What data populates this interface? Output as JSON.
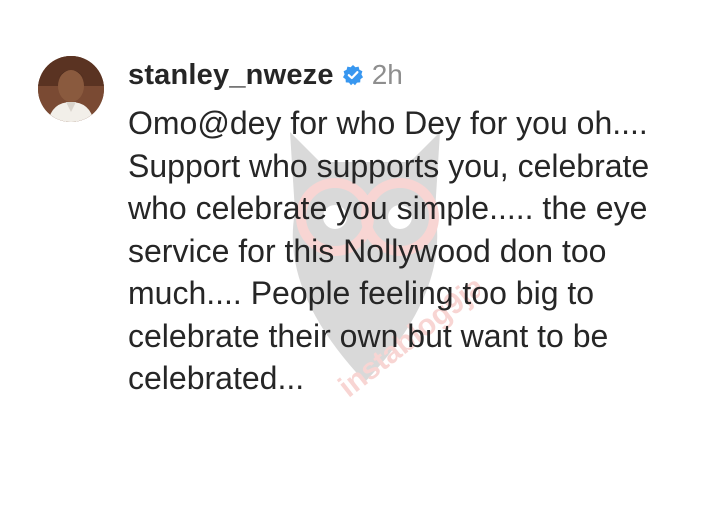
{
  "comment": {
    "username": "stanley_nweze",
    "verified_icon": "verified-badge-icon",
    "timestamp": "2h",
    "text": "Omo@dey for who Dey for you oh.... Support who supports you, celebrate who celebrate you simple..... the eye service for this Nollywood don too much.... People feeling too big to celebrate their own but want to be celebrated...",
    "avatar_icon": "profile-photo"
  },
  "watermark": {
    "icon": "owl-watermark-icon",
    "text": "instablog9ja"
  },
  "colors": {
    "text": "#262626",
    "muted": "#8e8e8e",
    "verified_blue": "#3897f0",
    "watermark_red": "#e0463c"
  }
}
